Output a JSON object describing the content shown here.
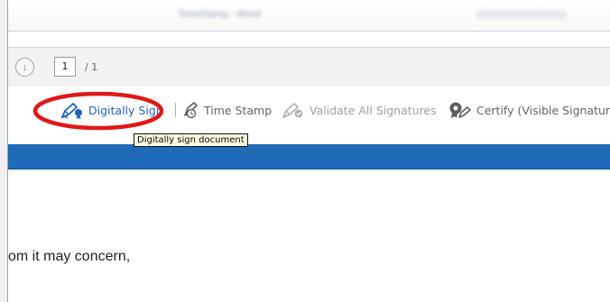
{
  "window": {
    "title": "TimeStamp - Word"
  },
  "navigation": {
    "page_current": "1",
    "page_total": "/ 1"
  },
  "signature_toolbar": {
    "digitally_sign": "Digitally Sign",
    "time_stamp": "Time Stamp",
    "validate_all": "Validate All Signatures",
    "certify_visible": "Certify (Visible Signature)"
  },
  "tooltip": {
    "text": "Digitally sign document"
  },
  "document": {
    "body_text": "om it may concern,"
  },
  "colors": {
    "accent_blue": "#1f6bb8",
    "highlight_red": "#e01818",
    "tooltip_bg": "#ffffe1"
  }
}
